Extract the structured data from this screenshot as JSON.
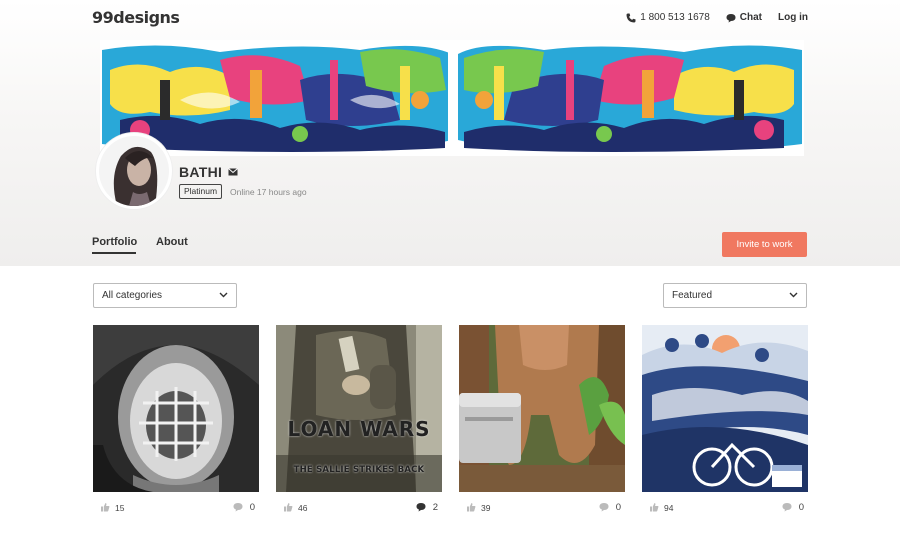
{
  "header": {
    "logo": "99designs",
    "phone": "1 800 513 1678",
    "chat": "Chat",
    "login": "Log in"
  },
  "profile": {
    "name": "BATHI",
    "level": "Platinum",
    "status": "Online 17 hours ago"
  },
  "tabs": [
    "Portfolio",
    "About"
  ],
  "active_tab": "Portfolio",
  "invite_button": "Invite to work",
  "filters": {
    "category": "All categories",
    "sort": "Featured"
  },
  "colors": {
    "accent": "#f07860",
    "text": "#333333",
    "muted": "#888888"
  },
  "cards": [
    {
      "artwork": "hockey goalie mask illustration",
      "likes": "15",
      "comments": "0"
    },
    {
      "artwork": "LOAN WARS",
      "subtitle": "THE SALLIE STRIKES BACK",
      "likes": "46",
      "comments": "2"
    },
    {
      "artwork": "bear and cooler illustration",
      "likes": "39",
      "comments": "0"
    },
    {
      "artwork": "outdoor adventure illustration",
      "likes": "94",
      "comments": "0"
    }
  ]
}
